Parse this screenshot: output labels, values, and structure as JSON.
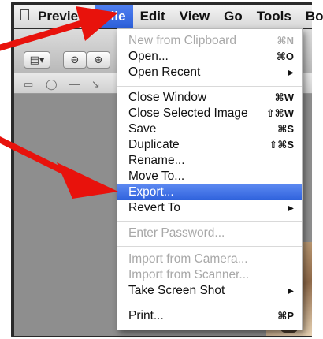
{
  "menubar": {
    "apple_icon": "apple-logo",
    "items": [
      {
        "label": "Preview"
      },
      {
        "label": "File"
      },
      {
        "label": "Edit"
      },
      {
        "label": "View"
      },
      {
        "label": "Go"
      },
      {
        "label": "Tools"
      },
      {
        "label": "Bo"
      }
    ]
  },
  "file_menu": {
    "items": [
      {
        "label": "New from Clipboard",
        "shortcut": "⌘N",
        "enabled": false
      },
      {
        "label": "Open...",
        "shortcut": "⌘O",
        "enabled": true
      },
      {
        "label": "Open Recent",
        "submenu": true,
        "enabled": true
      },
      {
        "label": "Close Window",
        "shortcut": "⌘W",
        "enabled": true
      },
      {
        "label": "Close Selected Image",
        "shortcut": "⇧⌘W",
        "enabled": true
      },
      {
        "label": "Save",
        "shortcut": "⌘S",
        "enabled": true
      },
      {
        "label": "Duplicate",
        "shortcut": "⇧⌘S",
        "enabled": true
      },
      {
        "label": "Rename...",
        "enabled": true
      },
      {
        "label": "Move To...",
        "enabled": true
      },
      {
        "label": "Export...",
        "enabled": true,
        "highlighted": true
      },
      {
        "label": "Revert To",
        "submenu": true,
        "enabled": true
      },
      {
        "label": "Enter Password...",
        "enabled": false
      },
      {
        "label": "Import from Camera...",
        "enabled": false
      },
      {
        "label": "Import from Scanner...",
        "enabled": false
      },
      {
        "label": "Take Screen Shot",
        "submenu": true,
        "enabled": true
      },
      {
        "label": "Print...",
        "shortcut": "⌘P",
        "enabled": true
      }
    ],
    "submenu_glyph": "▶"
  },
  "colors": {
    "highlight": "#2f62dc",
    "arrow": "#e8120c"
  }
}
